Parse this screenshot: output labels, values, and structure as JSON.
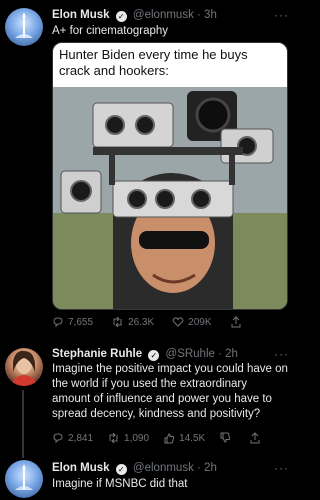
{
  "tweet1": {
    "name": "Elon Musk",
    "handle": "@elonmusk",
    "time": "· 3h",
    "text": "A+ for cinematography",
    "image_caption": "Hunter Biden every time he buys crack and hookers:",
    "stats": {
      "replies": "7,655",
      "retweets": "26.3K",
      "likes": "209K"
    }
  },
  "tweet2": {
    "name": "Stephanie Ruhle",
    "handle": "@SRuhle",
    "time": "· 2h",
    "text": "Imagine the positive impact you could have on the world if you used the extraordinary amount of influence and power you have to spread decency, kindness and positivity?",
    "stats": {
      "replies": "2,841",
      "retweets": "1,090",
      "likes": "14.5K"
    }
  },
  "tweet3": {
    "name": "Elon Musk",
    "handle": "@elonmusk",
    "time": "· 2h",
    "text": "Imagine if MSNBC did that"
  },
  "icons": {
    "more": "more-icon",
    "verified": "verified-badge-icon",
    "reply": "reply-icon",
    "retweet": "retweet-icon",
    "like": "like-icon",
    "share": "share-icon",
    "dislike": "dislike-icon"
  },
  "colors": {
    "background": "#000000",
    "text": "#e7e9ea",
    "muted": "#71767b"
  },
  "ui": {
    "more_glyph": "···",
    "verified_glyph": "✓"
  }
}
